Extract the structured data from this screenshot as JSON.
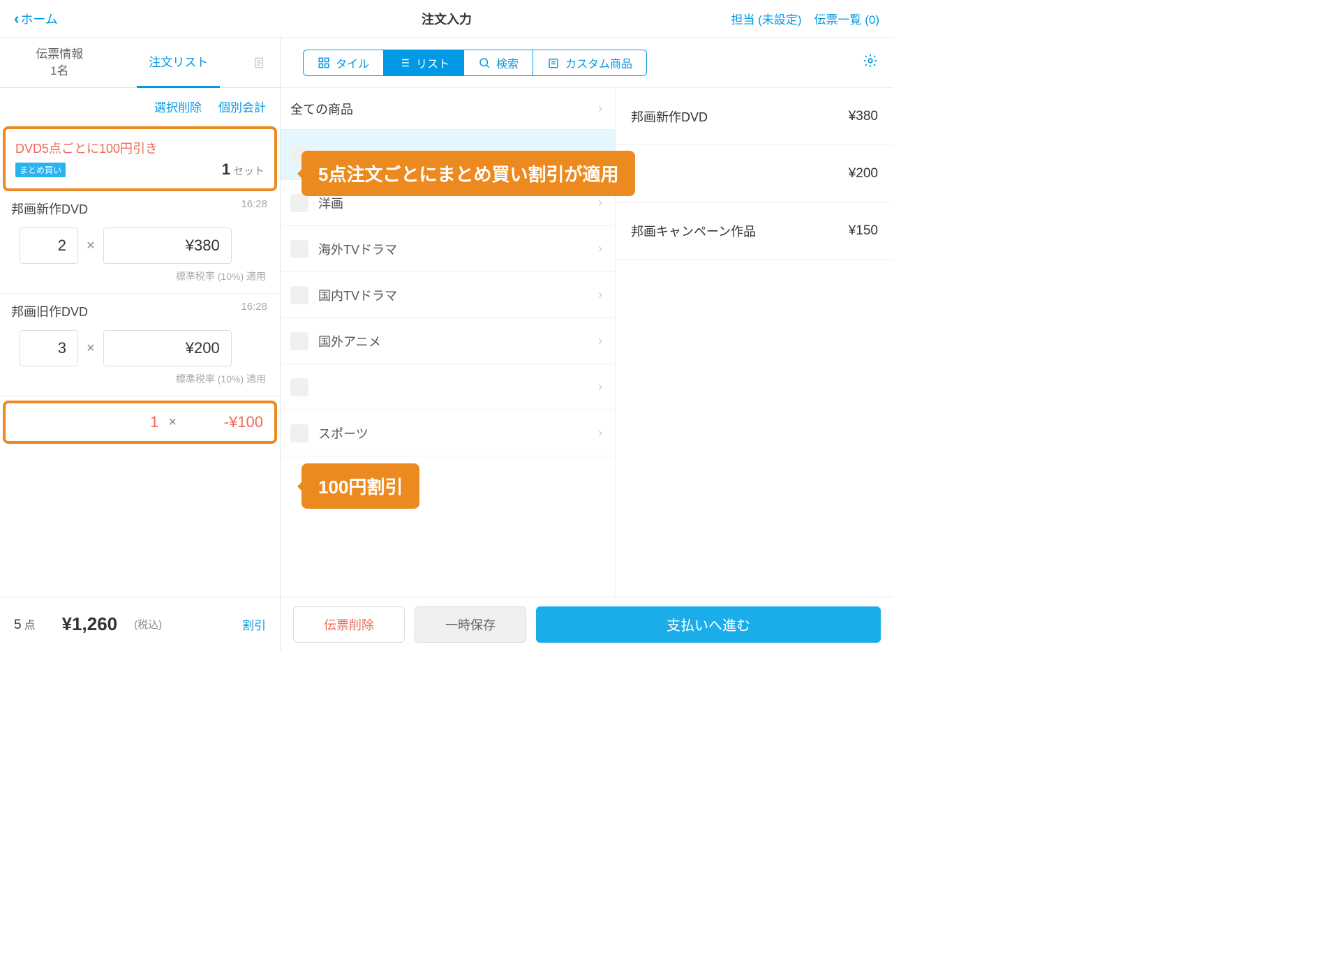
{
  "header": {
    "back": "ホーム",
    "title": "注文入力",
    "staff": "担当 (未設定)",
    "slips": "伝票一覧 (0)"
  },
  "tabs": {
    "info": "伝票情報\n1名",
    "list": "注文リスト"
  },
  "sub": {
    "del": "選択削除",
    "split": "個別会計"
  },
  "discount_card": {
    "title": "DVD5点ごとに100円引き",
    "badge": "まとめ買い",
    "qty": "1",
    "unit": "セット"
  },
  "items": [
    {
      "name": "邦画新作DVD",
      "time": "16:28",
      "qty": "2",
      "price": "¥380",
      "tax": "標準税率 (10%) 適用"
    },
    {
      "name": "邦画旧作DVD",
      "time": "16:28",
      "qty": "3",
      "price": "¥200",
      "tax": "標準税率 (10%) 適用"
    }
  ],
  "discount_line": {
    "qty": "1",
    "price": "-¥100"
  },
  "footer": {
    "qty": "5",
    "unit": "点",
    "total": "¥1,260",
    "tax": "(税込)",
    "discount": "割引"
  },
  "modes": {
    "tile": "タイル",
    "list": "リスト",
    "search": "検索",
    "custom": "カスタム商品"
  },
  "categories": {
    "all": "全ての商品",
    "rows": [
      "洋画",
      "海外TVドラマ",
      "国内TVドラマ",
      "国外アニメ",
      "",
      "スポーツ"
    ]
  },
  "center_footer": {
    "del": "伝票削除",
    "save": "一時保存",
    "pay": "支払いへ進む"
  },
  "products": [
    {
      "name": "邦画新作DVD",
      "price": "¥380"
    },
    {
      "name": "",
      "price": "¥200"
    },
    {
      "name": "邦画キャンペーン作品",
      "price": "¥150"
    }
  ],
  "callouts": {
    "c1": "5点注文ごとにまとめ買い割引が適用",
    "c2": "100円割引"
  },
  "mult": "×"
}
